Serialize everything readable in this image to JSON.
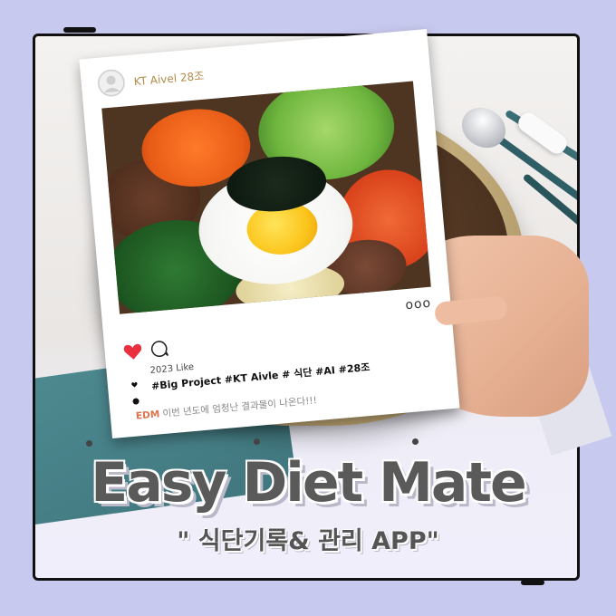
{
  "post": {
    "username": "KT Aivel 28조",
    "likes": "2023 Like",
    "hashtags": "#Big Project #KT Aivle # 식단 #AI #28조",
    "caption_tag": "EDM",
    "caption_text": " 이번 년도에 엄청난 결과물이 나온다!!!",
    "more_dots": "ooo"
  },
  "banner": {
    "title": "Easy Diet Mate",
    "subtitle": "\" 식단기록& 관리 APP\""
  },
  "colors": {
    "background": "#c8c9ee",
    "heart": "#e8303f",
    "caption_tag": "#e0734e",
    "username": "#b48a4a"
  },
  "icons": [
    "avatar-icon",
    "heart-icon",
    "comment-icon",
    "more-icon"
  ]
}
